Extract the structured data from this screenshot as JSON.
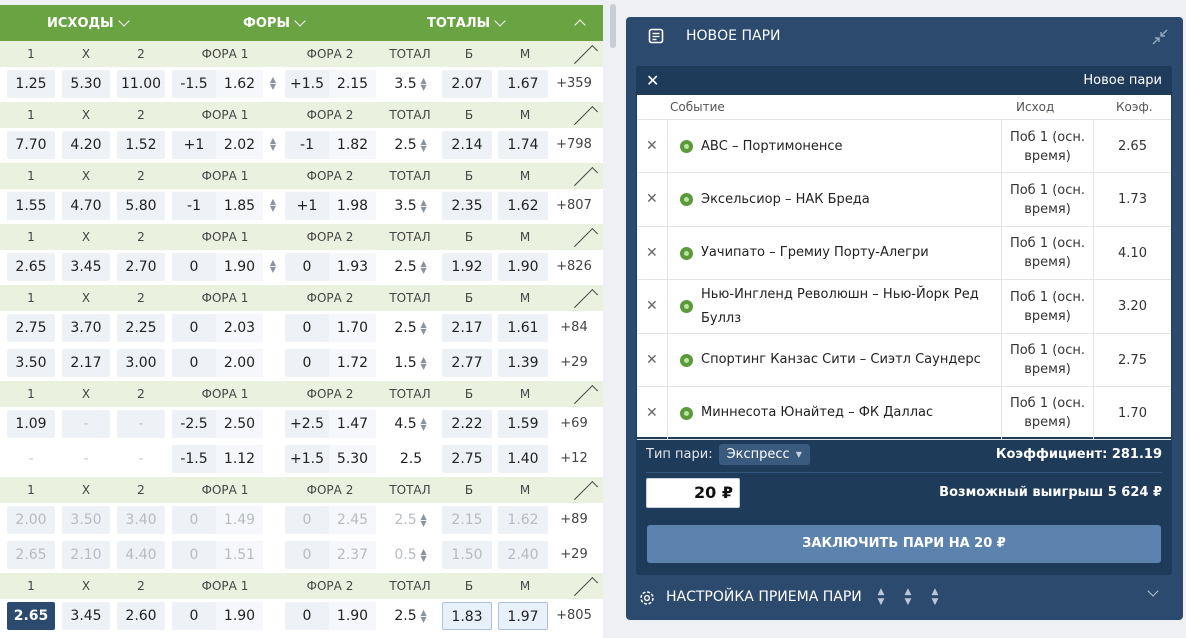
{
  "topbar": {
    "outcomes": "ИСХОДЫ",
    "handicaps": "ФОРЫ",
    "totals": "ТОТАЛЫ"
  },
  "header_labels": [
    "1",
    "X",
    "2",
    "ФОРА 1",
    "ФОРА 2",
    "ТОТАЛ",
    "Б",
    "М"
  ],
  "blocks": [
    {
      "rows": [
        {
          "o1": "1.25",
          "ox": "5.30",
          "o2": "11.00",
          "h1": "-1.5",
          "h1o": "1.62",
          "h2": "+1.5",
          "h2o": "2.15",
          "t": "3.5",
          "tb": "2.07",
          "tm": "1.67",
          "more": "+359",
          "spin": true
        }
      ]
    },
    {
      "rows": [
        {
          "o1": "7.70",
          "ox": "4.20",
          "o2": "1.52",
          "h1": "+1",
          "h1o": "2.02",
          "h2": "-1",
          "h2o": "1.82",
          "t": "2.5",
          "tb": "2.14",
          "tm": "1.74",
          "more": "+798",
          "spin": true
        }
      ]
    },
    {
      "rows": [
        {
          "o1": "1.55",
          "ox": "4.70",
          "o2": "5.80",
          "h1": "-1",
          "h1o": "1.85",
          "h2": "+1",
          "h2o": "1.98",
          "t": "3.5",
          "tb": "2.35",
          "tm": "1.62",
          "more": "+807",
          "spin": true
        }
      ]
    },
    {
      "rows": [
        {
          "o1": "2.65",
          "ox": "3.45",
          "o2": "2.70",
          "h1": "0",
          "h1o": "1.90",
          "h2": "0",
          "h2o": "1.93",
          "t": "2.5",
          "tb": "1.92",
          "tm": "1.90",
          "more": "+826",
          "spin": true
        }
      ]
    },
    {
      "rows": [
        {
          "o1": "2.75",
          "ox": "3.70",
          "o2": "2.25",
          "h1": "0",
          "h1o": "2.03",
          "h2": "0",
          "h2o": "1.70",
          "t": "2.5",
          "tb": "2.17",
          "tm": "1.61",
          "more": "+84"
        },
        {
          "o1": "3.50",
          "ox": "2.17",
          "o2": "3.00",
          "h1": "0",
          "h1o": "2.00",
          "h2": "0",
          "h2o": "1.72",
          "t": "1.5",
          "tb": "2.77",
          "tm": "1.39",
          "more": "+29"
        }
      ]
    },
    {
      "rows": [
        {
          "o1": "1.09",
          "ox": "-",
          "o2": "-",
          "h1": "-2.5",
          "h1o": "2.50",
          "h2": "+2.5",
          "h2o": "1.47",
          "t": "4.5",
          "tb": "2.22",
          "tm": "1.59",
          "more": "+69"
        },
        {
          "o1": "-",
          "ox": "-",
          "o2": "-",
          "h1": "-1.5",
          "h1o": "1.12",
          "h2": "+1.5",
          "h2o": "5.30",
          "t": "2.5",
          "tb": "2.75",
          "tm": "1.40",
          "more": "+12",
          "plain": true
        }
      ]
    },
    {
      "rows": [
        {
          "o1": "2.00",
          "ox": "3.50",
          "o2": "3.40",
          "h1": "0",
          "h1o": "1.49",
          "h2": "0",
          "h2o": "2.45",
          "t": "2.5",
          "tb": "2.15",
          "tm": "1.62",
          "more": "+89",
          "muted": true
        },
        {
          "o1": "2.65",
          "ox": "2.10",
          "o2": "4.40",
          "h1": "0",
          "h1o": "1.51",
          "h2": "0",
          "h2o": "2.37",
          "t": "0.5",
          "tb": "1.50",
          "tm": "2.40",
          "more": "+29",
          "muted": true
        }
      ]
    },
    {
      "rows": [
        {
          "o1": "2.65",
          "ox": "3.45",
          "o2": "2.60",
          "h1": "0",
          "h1o": "1.90",
          "h2": "0",
          "h2o": "1.90",
          "t": "2.5",
          "tb": "1.83",
          "tm": "1.97",
          "more": "+805",
          "selected": true
        }
      ]
    }
  ],
  "slip": {
    "title": "НОВОЕ ПАРИ",
    "card_name": "Новое пари",
    "col_event": "Событие",
    "col_outcome": "Исход",
    "col_coef": "Коэф.",
    "bets": [
      {
        "event": "АВС – Портимоненсе",
        "outcome": "Поб 1 (осн. время)",
        "coef": "2.65"
      },
      {
        "event": "Эксельсиор – НАК Бреда",
        "outcome": "Поб 1 (осн. время)",
        "coef": "1.73"
      },
      {
        "event": "Уачипато – Гремиу Порту-Алегри",
        "outcome": "Поб 1 (осн. время)",
        "coef": "4.10"
      },
      {
        "event": "Нью-Ингленд Революшн – Нью-Йорк Ред Буллз",
        "outcome": "Поб 1 (осн. время)",
        "coef": "3.20"
      },
      {
        "event": "Спортинг Канзас Сити – Сиэтл Саундерс",
        "outcome": "Поб 1 (осн. время)",
        "coef": "2.75"
      },
      {
        "event": "Миннесота Юнайтед – ФК Даллас",
        "outcome": "Поб 1 (осн. время)",
        "coef": "1.70"
      }
    ],
    "type_label": "Тип пари:",
    "type_value": "Экспресс",
    "coef_label": "Коэффициент: 281.19",
    "stake": "20 ₽",
    "win_label": "Возможный выигрыш 5 624 ₽",
    "button": "ЗАКЛЮЧИТЬ ПАРИ НА 20 ₽",
    "setting_label": "НАСТРОЙКА ПРИЕМА ПАРИ"
  },
  "colors": {
    "green": "#6aa442",
    "slip": "#2b4a6d",
    "card": "#1f3b5a",
    "button": "#5c83ad",
    "selected": "#2a4a6e"
  }
}
